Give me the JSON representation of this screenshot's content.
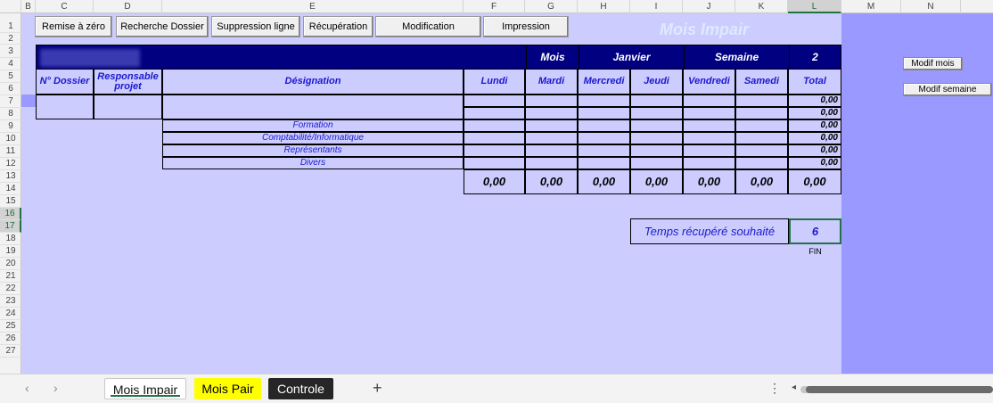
{
  "columns": [
    "B",
    "C",
    "D",
    "E",
    "F",
    "G",
    "H",
    "I",
    "J",
    "K",
    "L",
    "M",
    "N"
  ],
  "rows": [
    "1",
    "2",
    "3",
    "4",
    "5",
    "6",
    "7",
    "8",
    "9",
    "10",
    "11",
    "12",
    "13",
    "14",
    "15",
    "16",
    "17",
    "18",
    "19",
    "20",
    "21",
    "22",
    "23",
    "24",
    "25",
    "26",
    "27"
  ],
  "toolbar": {
    "reset": "Remise à zéro",
    "search": "Recherche Dossier",
    "delete_line": "Suppression ligne",
    "recovery": "Récupération",
    "modify": "Modification",
    "print": "Impression"
  },
  "sheet_title": "Mois Impair",
  "side_buttons": {
    "month": "Modif mois",
    "week": "Modif semaine"
  },
  "header_bar": {
    "mois_label": "Mois",
    "mois_value": "Janvier",
    "semaine_label": "Semaine",
    "semaine_value": "2"
  },
  "table_headers": {
    "dossier": "N° Dossier",
    "responsable": "Responsable projet",
    "designation": "Désignation",
    "days": [
      "Lundi",
      "Mardi",
      "Mercredi",
      "Jeudi",
      "Vendredi",
      "Samedi"
    ],
    "total": "Total"
  },
  "categories": [
    "Formation",
    "Comptabilité/Informatique",
    "Représentants",
    "Divers"
  ],
  "row_totals": [
    "0,00",
    "0,00",
    "0,00",
    "0,00",
    "0,00",
    "0,00"
  ],
  "day_sums": [
    "0,00",
    "0,00",
    "0,00",
    "0,00",
    "0,00",
    "0,00",
    "0,00"
  ],
  "recup": {
    "label": "Temps récupéré souhaité",
    "value": "6",
    "end": "FIN"
  },
  "tabs": {
    "tab1": "Mois Impair",
    "tab2": "Mois Pair",
    "tab3": "Controle",
    "add": "+"
  },
  "nav": {
    "prev": "‹",
    "next": "›",
    "more": "⋮",
    "scroll_left": "◂"
  },
  "colors": {
    "sheet_bg": "#ccccff",
    "panel_bg": "#9999ff",
    "header_navy": "#000080",
    "text_blue": "#1a1acc",
    "tab_yellow": "#ffff00",
    "tab_dark": "#262626"
  }
}
